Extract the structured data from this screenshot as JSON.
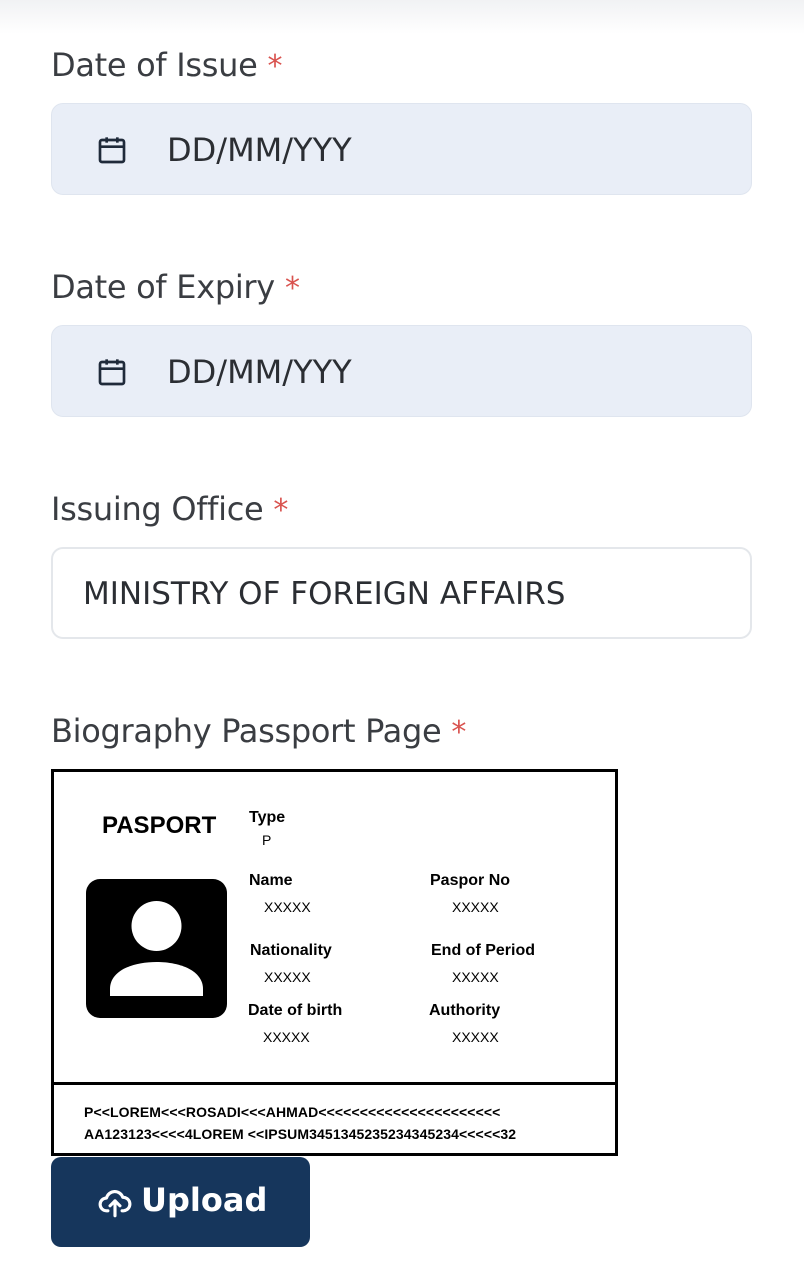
{
  "form": {
    "date_of_issue": {
      "label": "Date of Issue",
      "required_mark": "*",
      "placeholder": "DD/MM/YYY"
    },
    "date_of_expiry": {
      "label": "Date of Expiry",
      "required_mark": "*",
      "placeholder": "DD/MM/YYY"
    },
    "issuing_office": {
      "label": "Issuing Office",
      "required_mark": "*",
      "value": "MINISTRY OF FOREIGN AFFAIRS"
    },
    "biography_page": {
      "label": "Biography Passport Page",
      "required_mark": "*"
    }
  },
  "passport": {
    "title": "PASPORT",
    "type_label": "Type",
    "type_value": "P",
    "name_label": "Name",
    "name_value": "XXXXX",
    "passport_no_label": "Paspor No",
    "passport_no_value": "XXXXX",
    "nationality_label": "Nationality",
    "nationality_value": "XXXXX",
    "end_period_label": "End of Period",
    "end_period_value": "XXXXX",
    "dob_label": "Date of birth",
    "dob_value": "XXXXX",
    "authority_label": "Authority",
    "authority_value": "XXXXX",
    "mrz_line1": "P<<LOREM<<<ROSADI<<<AHMAD<<<<<<<<<<<<<<<<<<<<<<",
    "mrz_line2": "AA123123<<<<4LOREM <<IPSUM3451345235234345234<<<<<32"
  },
  "upload_button": {
    "label": "Upload",
    "icon": "cloud-upload-icon"
  },
  "colors": {
    "date_field_bg": "#e9eef7",
    "required": "#d9534f",
    "upload_bg": "#16365c"
  }
}
